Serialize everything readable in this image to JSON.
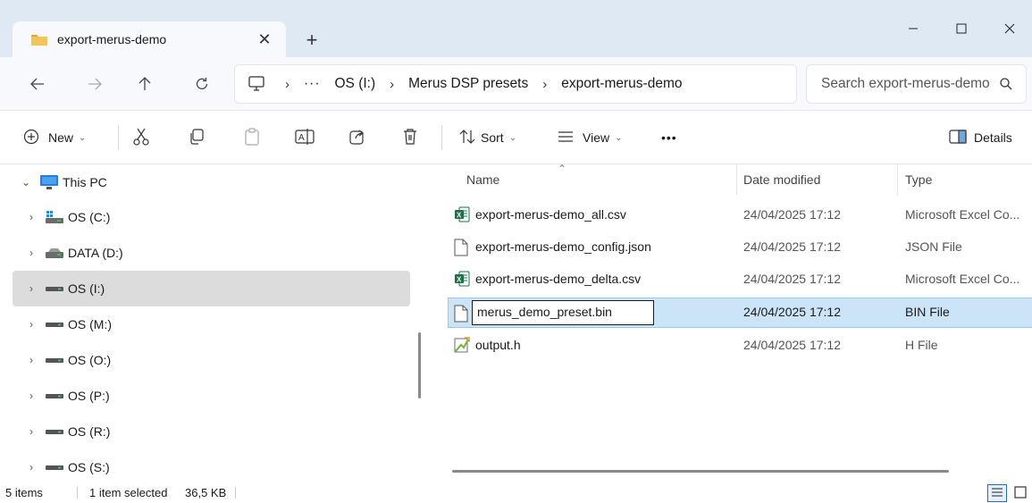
{
  "tab": {
    "title": "export-merus-demo"
  },
  "address": {
    "ellipsis": "···",
    "crumbs": [
      "OS (I:)",
      "Merus DSP presets",
      "export-merus-demo"
    ]
  },
  "search": {
    "placeholder": "Search export-merus-demo"
  },
  "commands": {
    "new": "New",
    "sort": "Sort",
    "view": "View",
    "more": "•••",
    "details": "Details"
  },
  "sidebar": {
    "items": [
      {
        "label": "This PC",
        "icon": "computer-icon"
      },
      {
        "label": "OS (C:)",
        "icon": "windows-drive-icon"
      },
      {
        "label": "DATA (D:)",
        "icon": "drive-icon"
      },
      {
        "label": "OS (I:)",
        "icon": "drive-icon"
      },
      {
        "label": "OS (M:)",
        "icon": "drive-icon"
      },
      {
        "label": "OS (O:)",
        "icon": "drive-icon"
      },
      {
        "label": "OS (P:)",
        "icon": "drive-icon"
      },
      {
        "label": "OS (R:)",
        "icon": "drive-icon"
      },
      {
        "label": "OS (S:)",
        "icon": "drive-icon"
      }
    ]
  },
  "columns": {
    "name": "Name",
    "date": "Date modified",
    "type": "Type"
  },
  "files": [
    {
      "name": "export-merus-demo_all.csv",
      "date": "24/04/2025 17:12",
      "type": "Microsoft Excel Co...",
      "icon": "excel-file-icon"
    },
    {
      "name": "export-merus-demo_config.json",
      "date": "24/04/2025 17:12",
      "type": "JSON File",
      "icon": "blank-file-icon"
    },
    {
      "name": "export-merus-demo_delta.csv",
      "date": "24/04/2025 17:12",
      "type": "Microsoft Excel Co...",
      "icon": "excel-file-icon"
    },
    {
      "name": "merus_demo_preset.bin",
      "date": "24/04/2025 17:12",
      "type": "BIN File",
      "icon": "blank-file-icon",
      "renaming": true
    },
    {
      "name": "output.h",
      "date": "24/04/2025 17:12",
      "type": "H File",
      "icon": "header-file-icon"
    }
  ],
  "status": {
    "count": "5 items",
    "selected": "1 item selected",
    "size": "36,5 KB"
  },
  "colors": {
    "selection": "#cce4f7",
    "titlebar": "#dfe9f4",
    "sidebar_selected": "#dcdcdc",
    "accent": "#1f6fc5"
  }
}
